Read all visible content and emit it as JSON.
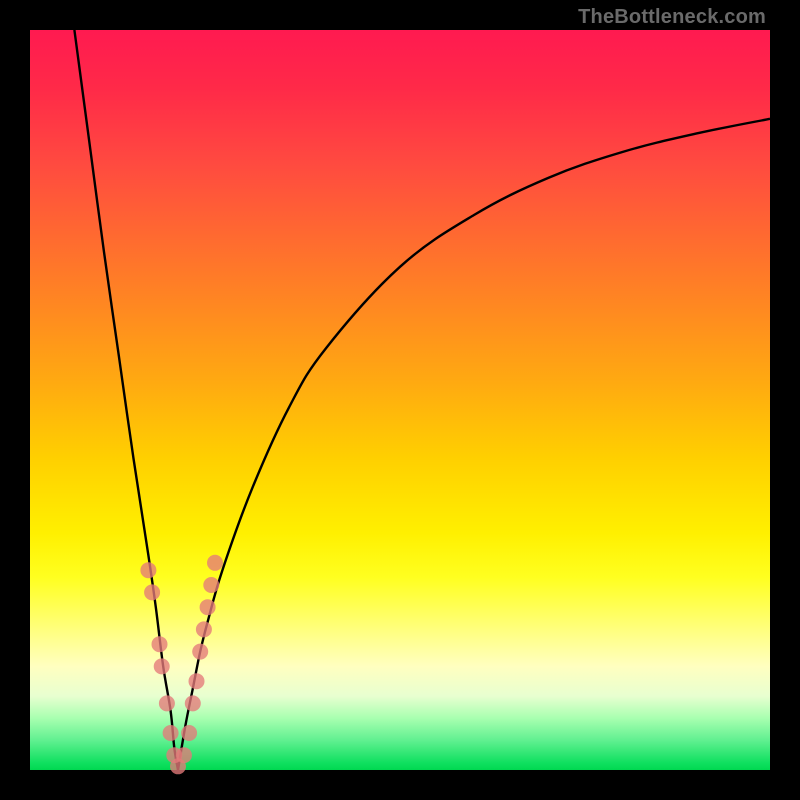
{
  "watermark": "TheBottleneck.com",
  "colors": {
    "frame": "#000000",
    "curve": "#000000",
    "marker": "#e47a7a"
  },
  "chart_data": {
    "type": "line",
    "title": "",
    "xlabel": "",
    "ylabel": "",
    "xlim": [
      0,
      100
    ],
    "ylim": [
      0,
      100
    ],
    "grid": false,
    "curve_left": {
      "x": [
        6,
        8,
        10,
        12,
        14,
        16,
        17,
        18,
        19,
        19.5,
        20
      ],
      "values": [
        100,
        85,
        70,
        56,
        42,
        29,
        22,
        14,
        8,
        3,
        0
      ]
    },
    "curve_right": {
      "x": [
        20,
        21,
        22,
        23,
        24,
        26,
        30,
        35,
        40,
        50,
        60,
        70,
        80,
        90,
        100
      ],
      "values": [
        0,
        6,
        11,
        16,
        20,
        27,
        38,
        49,
        57,
        68,
        75,
        80,
        83.5,
        86,
        88
      ]
    },
    "scatter_markers": [
      {
        "x": 16.0,
        "y": 27
      },
      {
        "x": 16.5,
        "y": 24
      },
      {
        "x": 17.5,
        "y": 17
      },
      {
        "x": 17.8,
        "y": 14
      },
      {
        "x": 18.5,
        "y": 9
      },
      {
        "x": 19.0,
        "y": 5
      },
      {
        "x": 19.5,
        "y": 2
      },
      {
        "x": 20.0,
        "y": 0.5
      },
      {
        "x": 20.8,
        "y": 2
      },
      {
        "x": 21.5,
        "y": 5
      },
      {
        "x": 22.0,
        "y": 9
      },
      {
        "x": 22.5,
        "y": 12
      },
      {
        "x": 23.0,
        "y": 16
      },
      {
        "x": 23.5,
        "y": 19
      },
      {
        "x": 24.0,
        "y": 22
      },
      {
        "x": 24.5,
        "y": 25
      },
      {
        "x": 25.0,
        "y": 28
      }
    ]
  }
}
